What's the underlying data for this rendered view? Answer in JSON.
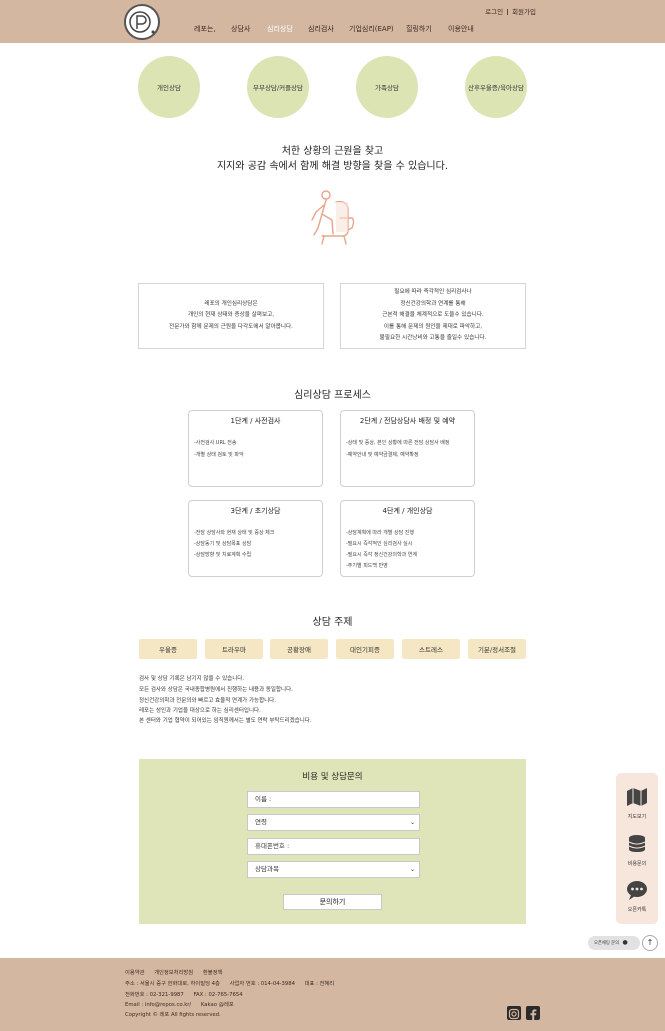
{
  "header": {
    "login": "로그인",
    "join": "회원가입",
    "nav": [
      "레포는,",
      "상담사",
      "심리상담",
      "심리검사",
      "기업심리(EAP)",
      "힐링하기",
      "이용안내"
    ],
    "active_nav_color": "#ffffff"
  },
  "services": [
    "개인상담",
    "부부상담/커플상담",
    "가족상담",
    "산후우울증/육아상담"
  ],
  "intro": {
    "line1": "처한 상황의 근원을 찾고",
    "line2": "지지와 공감 속에서 함께 해결 방향을 찾을 수 있습니다."
  },
  "desc_left": [
    "레포의 개인심리상담은",
    "개인의 현재 상태와 증상을 살펴보고,",
    "전문가와 함께 문제의 근원을 다각도에서 알아봅니다."
  ],
  "desc_right": [
    "필요에 따라 즉각적인 심리검사나",
    "정신건강의학과 연계를 통해",
    "근본적 해결을 체계적으로 도울수 있습니다.",
    "이를 통해 문제의 원인을 제대로 파악하고,",
    "불필요한 시간낭비와 고통을 줄일수 있습니다."
  ],
  "process": {
    "title": "심리상담 프로세스",
    "steps": [
      {
        "title": "1단계 / 사전검사",
        "items": [
          "-사전검사 URL 전송",
          "-개별 상태 검토 및 파악"
        ]
      },
      {
        "title": "2단계 / 전담상담사 배정 및 예약",
        "items": [
          "-상태 및 증상, 본인 상황에 따른 전담 상담사 배정",
          "-예약안내 및 예약금결제, 예약확정"
        ]
      },
      {
        "title": "3단계 / 초기상담",
        "items": [
          "-전담 상담사와 현재 상태 및 증상 체크",
          "-상담동기 및 상담목표 상담",
          "-상담방향 및 치료계획 수립"
        ]
      },
      {
        "title": "4단계 / 개인상담",
        "items": [
          "-상담계획에 따라 개별 상담 진행",
          "-필요시 즉각적인 심리검사 실시",
          "-필요시 즉각 정신건강의학과 연계",
          "-주기별 피드백 반영"
        ]
      }
    ]
  },
  "topics": {
    "title": "상담 주제",
    "items": [
      "우울증",
      "트라우마",
      "공황장애",
      "대인기피증",
      "스트레스",
      "기분/정서조절"
    ]
  },
  "notes": [
    "검사 및 상담 기록은 남기지 않을 수 있습니다.",
    "모든 검사와 상담은 국내종합병원에서 진행하는 내용과 동일합니다.",
    "정신건강의학과 전문의와 빠르고 효율적 연계가 가능합니다.",
    "레포는 성인과 기업을 대상으로 하는 심리센터입니다.",
    "본 센터와 기업 협약이 되어있는 임직원께서는 별도 연락 부탁드리겠습니다."
  ],
  "inquiry": {
    "title": "비용 및 상담문의",
    "name_placeholder": "이름 :",
    "age_select": "연령",
    "phone_placeholder": "휴대폰번호 :",
    "subject_select": "상담과목",
    "submit": "문의하기"
  },
  "float_menu": {
    "map": "지도보기",
    "cost": "비용문의",
    "kakao": "오픈카톡",
    "chat": "오픈채팅 문의",
    "top_icon": "arrow-up-icon"
  },
  "footer": {
    "links": [
      "이용약관",
      "개인정보처리방침",
      "환불정책"
    ],
    "address_label": "주소 : 서울시 중구 한화대로, 하이빌딩 4층",
    "biz_no": "사업자 번호 : 014-04-3984",
    "ceo": "대표 : 전혜리",
    "tel": "전화번호 : 02-321-9987",
    "fax": "FAX : 02-765-7654",
    "email": "Email : info@repos.co.kr/",
    "kakao": "Kakao @레포",
    "copyright": "Copyright © 레포 All fights reserved."
  },
  "colors": {
    "header_bg": "#d4b7a0",
    "circle_bg": "#dde4b4",
    "topic_bg": "#f5e7c4",
    "inquiry_bg": "#dfe5b8",
    "float_bg": "#f6e6db"
  }
}
